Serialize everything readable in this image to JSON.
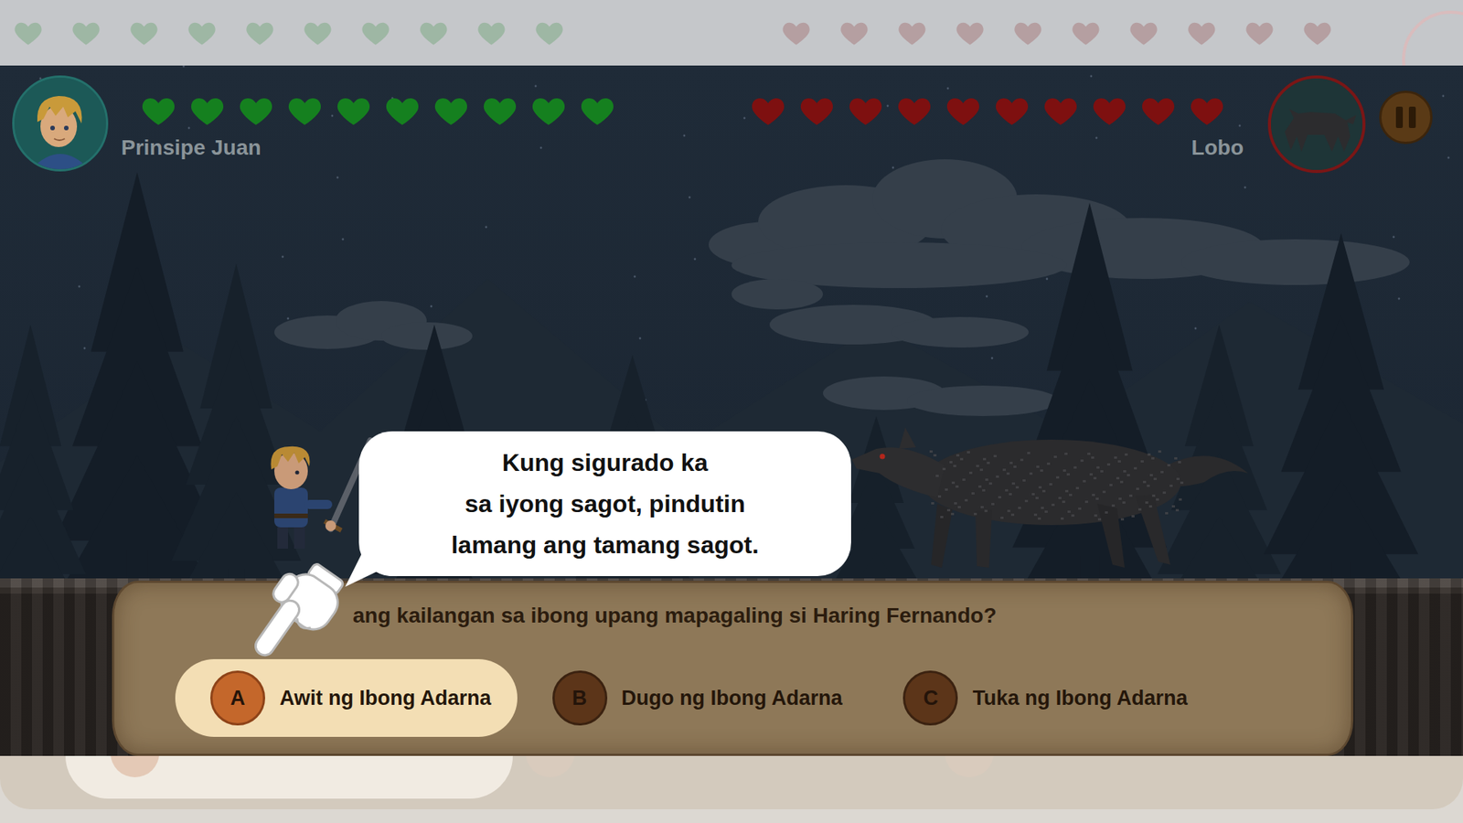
{
  "fighters": [
    {
      "name": "Prinsipe Juan",
      "side": "player",
      "color": "#15801f",
      "hearts": [
        {
          "filled": true
        },
        {
          "filled": true
        },
        {
          "filled": true
        },
        {
          "filled": true
        },
        {
          "filled": true
        },
        {
          "filled": true
        },
        {
          "filled": true
        },
        {
          "filled": true
        },
        {
          "filled": true
        },
        {
          "filled": true
        }
      ]
    },
    {
      "name": "Lobo",
      "side": "enemy",
      "color": "#7e1010",
      "hearts": [
        {
          "filled": true
        },
        {
          "filled": true
        },
        {
          "filled": true
        },
        {
          "filled": true
        },
        {
          "filled": true
        },
        {
          "filled": true
        },
        {
          "filled": true
        },
        {
          "filled": true
        },
        {
          "filled": true
        },
        {
          "filled": true
        }
      ]
    }
  ],
  "tutorial": {
    "lines": [
      "Kung sigurado ka",
      "sa iyong sagot, pindutin",
      "lamang ang tamang sagot."
    ]
  },
  "question": {
    "text": "ang kailangan sa ibong upang mapagaling si Haring Fernando?"
  },
  "options": [
    {
      "letter": "A",
      "text": "Awit ng Ibong Adarna",
      "selected": true
    },
    {
      "letter": "B",
      "text": "Dugo ng Ibong Adarna",
      "selected": false
    },
    {
      "letter": "C",
      "text": "Tuka ng Ibong Adarna",
      "selected": false
    }
  ]
}
